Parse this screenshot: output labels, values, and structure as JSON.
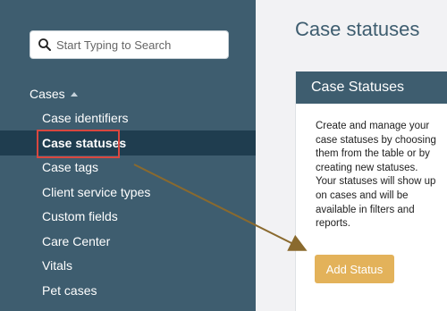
{
  "search": {
    "placeholder": "Start Typing to Search",
    "icon": "search-icon"
  },
  "sidebar": {
    "group_label": "Cases",
    "items": [
      {
        "label": "Case identifiers",
        "active": false
      },
      {
        "label": "Case statuses",
        "active": true
      },
      {
        "label": "Case tags",
        "active": false
      },
      {
        "label": "Client service types",
        "active": false
      },
      {
        "label": "Custom fields",
        "active": false
      },
      {
        "label": "Care Center",
        "active": false
      },
      {
        "label": "Vitals",
        "active": false
      },
      {
        "label": "Pet cases",
        "active": false
      }
    ]
  },
  "main": {
    "title": "Case statuses",
    "card": {
      "header": "Case Statuses",
      "description": "Create and manage your case statuses by choosing them from the table or by creating new statuses. Your statuses will show up on cases and will be available in filters and reports.",
      "button_label": "Add Status"
    }
  },
  "colors": {
    "sidebar_bg": "#3e5d6f",
    "active_item_bg": "#1f3d4f",
    "accent_button": "#e3b25a",
    "annotation_red": "#d9473f",
    "annotation_arrow": "#8a6a2e"
  }
}
